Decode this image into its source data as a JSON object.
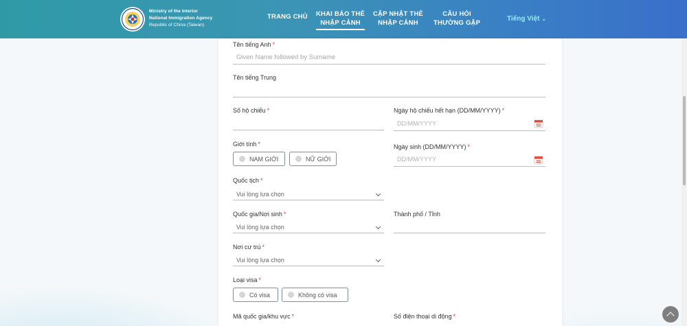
{
  "header": {
    "agency_lines": [
      "Ministry of the Interior",
      "National Immigration Agency",
      "Republic of China (Taiwan)"
    ],
    "nav": [
      {
        "lines": [
          "TRANG CHỦ"
        ]
      },
      {
        "lines": [
          "KHAI BÁO THẺ",
          "NHẬP CẢNH"
        ],
        "active": true
      },
      {
        "lines": [
          "CẬP NHẬT THẺ",
          "NHẬP CẢNH"
        ]
      },
      {
        "lines": [
          "CÂU HỎI",
          "THƯỜNG GẶP"
        ]
      }
    ],
    "language": "Tiếng Việt"
  },
  "form": {
    "english_name": {
      "label": "Tên tiếng Anh",
      "placeholder": "Given Name followed by Surname"
    },
    "chinese_name": {
      "label": "Tên tiếng Trung"
    },
    "passport_no": {
      "label": "Số hộ chiếu"
    },
    "passport_expiry": {
      "label": "Ngày hộ chiếu hết hạn (DD/MM/YYYY)",
      "placeholder": "DD/MM/YYYY"
    },
    "gender": {
      "label": "Giới tính",
      "options": [
        "NAM GIỚI",
        "NỮ GIỚI"
      ]
    },
    "birth_date": {
      "label": "Ngày sinh (DD/MM/YYYY)",
      "placeholder": "DD/MM/YYYY"
    },
    "nationality": {
      "label": "Quốc tịch",
      "value": "Vui lòng lựa chọn"
    },
    "birth_country": {
      "label": "Quốc gia/Nơi sinh",
      "value": "Vui lòng lựa chọn"
    },
    "city": {
      "label": "Thành phố / Tỉnh"
    },
    "residence": {
      "label": "Nơi cư trú",
      "value": "Vui lòng lựa chọn"
    },
    "visa_type": {
      "label": "Loại visa",
      "options": [
        "Có visa",
        "Không có visa"
      ]
    },
    "country_code": {
      "label": "Mã quốc gia/khu vực"
    },
    "mobile": {
      "label": "Số điện thoại di động"
    },
    "required_mark": "*"
  },
  "colors": {
    "accent": "#2f9aa6",
    "required": "#e53935",
    "lang": "#8ff0e8"
  }
}
